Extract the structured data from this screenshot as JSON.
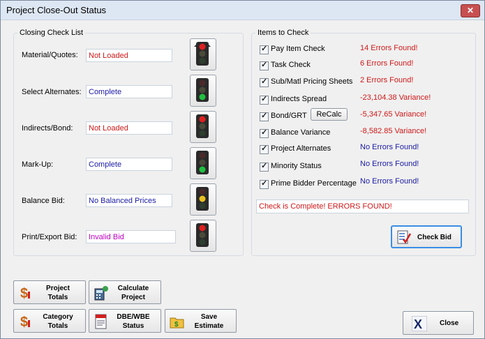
{
  "window": {
    "title": "Project Close-Out Status",
    "close_glyph": "✕"
  },
  "closing": {
    "legend": "Closing Check List",
    "items": [
      {
        "label": "Material/Quotes:",
        "value": "Not Loaded",
        "light": "red"
      },
      {
        "label": "Select Alternates:",
        "value": "Complete",
        "light": "green"
      },
      {
        "label": "Indirects/Bond:",
        "value": "Not Loaded",
        "light": "red"
      },
      {
        "label": "Mark-Up:",
        "value": "Complete",
        "light": "green"
      },
      {
        "label": "Balance Bid:",
        "value": "No Balanced Prices",
        "light": "yellow"
      },
      {
        "label": "Print/Export Bid:",
        "value": "Invalid Bid",
        "light": "red"
      }
    ]
  },
  "check": {
    "legend": "Items to Check",
    "items": [
      {
        "label": "Pay Item Check",
        "result": "14 Errors Found!",
        "status": "error"
      },
      {
        "label": "Task Check",
        "result": "6 Errors Found!",
        "status": "error"
      },
      {
        "label": "Sub/Matl Pricing Sheets",
        "result": "2 Errors Found!",
        "status": "error"
      },
      {
        "label": "Indirects Spread",
        "result": "-23,104.38 Variance!",
        "status": "error"
      },
      {
        "label": "Bond/GRT",
        "result": "-5,347.65 Variance!",
        "status": "error"
      },
      {
        "label": "Balance Variance",
        "result": "-8,582.85 Variance!",
        "status": "error"
      },
      {
        "label": "Project Alternates",
        "result": "No Errors Found!",
        "status": "ok"
      },
      {
        "label": "Minority Status",
        "result": "No Errors Found!",
        "status": "ok"
      },
      {
        "label": "Prime Bidder Percentage",
        "result": "No Errors Found!",
        "status": "ok"
      }
    ],
    "recalc_label": "ReCalc",
    "summary": "Check is Complete! ERRORS FOUND!",
    "check_bid_label": "Check Bid"
  },
  "buttons": {
    "project_totals": "Project\nTotals",
    "calculate_project": "Calculate\nProject",
    "category_totals": "Category\nTotals",
    "dbe_wbe_status": "DBE/WBE\nStatus",
    "save_estimate": "Save\nEstimate",
    "close": "Close"
  },
  "colors": {
    "error": "#d01818",
    "ok": "#1a1aa6",
    "invalid": "#c000c0"
  }
}
